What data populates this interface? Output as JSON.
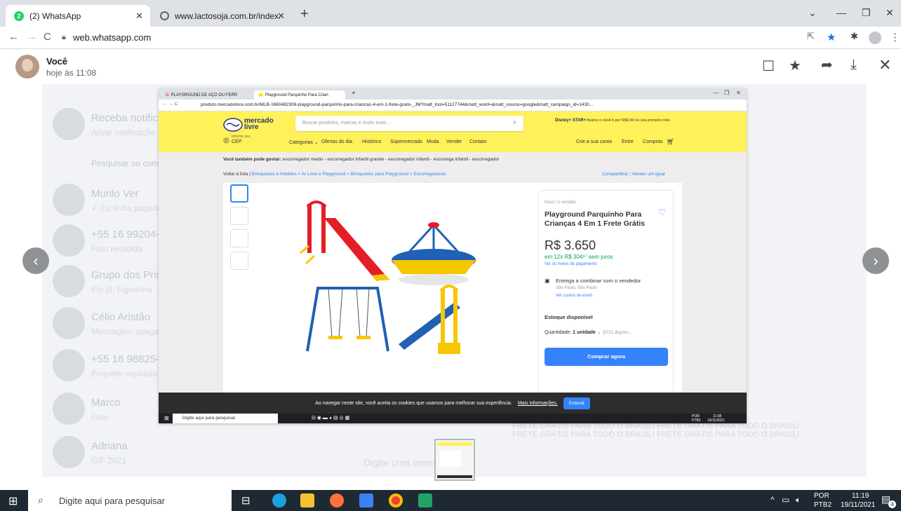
{
  "browser": {
    "tabs": [
      {
        "label": "(2) WhatsApp",
        "badge": "2",
        "active": true
      },
      {
        "label": "www.lactosoja.com.br/index.asp?",
        "active": false
      }
    ],
    "new_tab": "+",
    "url": "web.whatsapp.com"
  },
  "viewer": {
    "sender_name": "Você",
    "sender_time": "hoje às 11:08"
  },
  "chat_list_background": [
    {
      "name": "Receba notificaç",
      "sub": "Ativar notificaçõe"
    },
    {
      "name": "Pesquisar ou com",
      "sub": ""
    },
    {
      "name": "Murilo Ver",
      "sub": "✓ Eu tinha pagado"
    },
    {
      "name": "+55 16 99204-",
      "sub": "Foto recebida"
    },
    {
      "name": "Grupo dos Prin",
      "sub": "Elo 2l: Figurinha"
    },
    {
      "name": "Célio Aristão",
      "sub": "Mensagem apagada"
    },
    {
      "name": "+55 16 98825-",
      "sub": "Enquete expirada"
    },
    {
      "name": "Marco",
      "sub": "Foto"
    },
    {
      "name": "Adriana",
      "sub": "GIF 2021"
    }
  ],
  "message_input_placeholder": "Digite uma mensagem",
  "inner_browser": {
    "tabs": [
      {
        "label": "PLAYGROUND DE AÇO OU FERR",
        "active": false
      },
      {
        "label": "Playground Parquinho Para Crian",
        "active": true
      }
    ],
    "url": "produto.mercadolivre.com.br/MLB-1660482308-playground-parquinho-para-criancas-4-em-1-frete-gratis-_JM?matt_tool=51127744&matt_word=&matt_source=google&matt_campaign_id=1430..."
  },
  "mercadolivre": {
    "logo_text": "mercado livre",
    "search_placeholder": "Buscar produtos, marcas e muito mais...",
    "promo": "Assine o nível 6 por R$9,90 no seu primeiro mês",
    "promo_brand": "Disney+ STAR+",
    "cep_small": "Informe seu",
    "cep_label": "CEP",
    "nav": [
      "Categorias ⌄",
      "Ofertas do dia",
      "Histórico",
      "Supermercado",
      "Moda",
      "Vender",
      "Contato"
    ],
    "account_links": [
      "Crie a sua conta",
      "Entre",
      "Compras"
    ],
    "suggest_label": "Você também pode gostar:",
    "suggest_items": "escorregador medio - escorregador infantil grande - escorregador infantil - escorrega infantil - escorregador",
    "back_label": "Voltar à lista",
    "breadcrumbs": "Brinquedos e Hobbies > Ar Livre e Playground > Brinquedos para Playground > Escorregadores",
    "share": "Compartilhar",
    "sell_same": "Vender um igual",
    "condition": "Novo | 1 vendido",
    "title_line1": "Playground Parquinho Para",
    "title_line2": "Crianças 4 Em 1 Frete Grátis",
    "price": "R$ 3.650",
    "installments": "em 12x R$ 304⁹⁷ sem juros",
    "payment_link": "Ver os meios de pagamento",
    "delivery": "Entrega a combinar com o vendedor",
    "location": "São Paulo, São Paulo",
    "shipping_link": "Ver custos de envio",
    "stock": "Estoque disponível",
    "quantity_label": "Quantidade:",
    "quantity_value": "1 unidade",
    "quantity_avail": "(9721 disponí...",
    "buy_button": "Comprar agora"
  },
  "cookie": {
    "text": "Ao navegar neste site, você aceita os cookies que usamos para melhorar sua experiência.",
    "link": "Mais informações.",
    "button": "Entendi"
  },
  "inner_taskbar": {
    "search": "Digite aqui para pesquisar",
    "lang": "POR",
    "lang2": "PTB2",
    "time": "11:08",
    "date": "19/11/2021"
  },
  "taskbar": {
    "search": "Digite aqui para pesquisar",
    "lang": "POR",
    "lang2": "PTB2",
    "time": "11:19",
    "date": "19/11/2021",
    "notifications": "4"
  },
  "background_text": {
    "line1": "FRETE GRÁTIS PARA TODO O BRASIL! FRETE GRÁTIS PARA TODO O BRASIL!",
    "line2": "FRETE GRÁTIS PARA TODO O BRASIL! FRETE GRÁTIS PARA TODO O BRASIL!"
  },
  "colors": {
    "ml_yellow": "#fff159",
    "ml_blue": "#3483fa",
    "ml_green": "#00a650"
  }
}
